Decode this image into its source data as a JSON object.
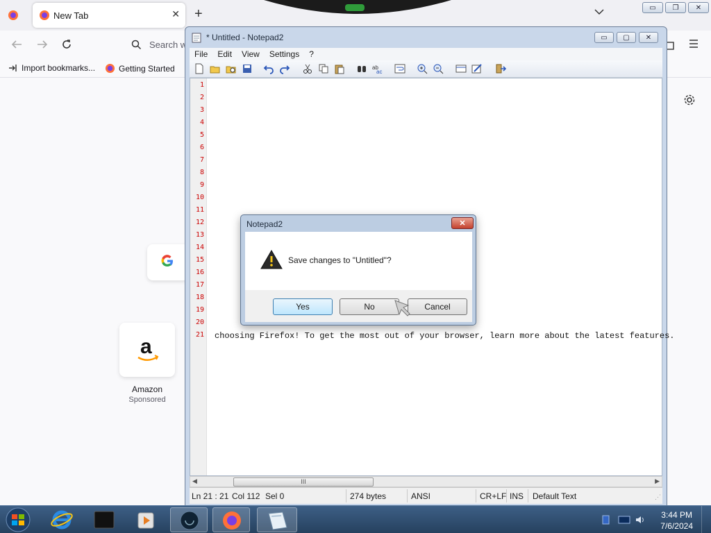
{
  "firefox": {
    "tab_title": "New Tab",
    "tab_close": "✕",
    "new_tab": "+",
    "search_placeholder": "Search w",
    "bookmarks": [
      {
        "label": "Import bookmarks...",
        "icon": "import-icon"
      },
      {
        "label": "Getting Started",
        "icon": "firefox-icon"
      }
    ],
    "shortcuts": [
      {
        "label": "Amazon",
        "sublabel": "Sponsored",
        "icon": "amazon-icon"
      }
    ]
  },
  "notepad": {
    "title": "* Untitled - Notepad2",
    "menu": [
      "File",
      "Edit",
      "View",
      "Settings",
      "?"
    ],
    "line_numbers": [
      "1",
      "2",
      "3",
      "4",
      "5",
      "6",
      "7",
      "8",
      "9",
      "10",
      "11",
      "12",
      "13",
      "14",
      "15",
      "16",
      "17",
      "18",
      "19",
      "20",
      "21"
    ],
    "visible_text": "choosing Firefox! To get the most out of your browser, learn more about the latest features.",
    "hscroll_grip": "III",
    "status": {
      "position": "Ln 21 : 21",
      "column": "Col 112",
      "selection": "Sel 0",
      "size": "274 bytes",
      "encoding": "ANSI",
      "eol": "CR+LF",
      "mode": "INS",
      "scheme": "Default Text"
    }
  },
  "dialog": {
    "title": "Notepad2",
    "close": "✕",
    "message": "Save changes to \"Untitled\"?",
    "buttons": {
      "yes": "Yes",
      "no": "No",
      "cancel": "Cancel"
    }
  },
  "taskbar": {
    "time": "3:44 PM",
    "date": "7/6/2024"
  },
  "colors": {
    "line_number": "#cc0000",
    "taskbar": "#2c4a6e",
    "dialog_titlebar": "#bccde2"
  }
}
